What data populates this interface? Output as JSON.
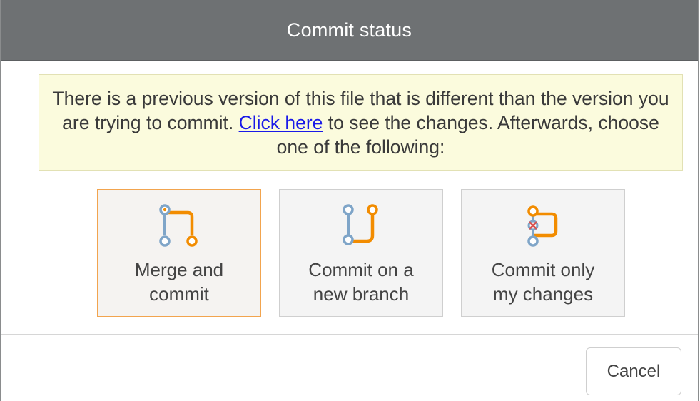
{
  "dialog": {
    "title": "Commit status"
  },
  "notice": {
    "text_before": "There is a previous version of this file that is different than the version you are trying to commit. ",
    "link_text": "Click here",
    "text_after": " to see the changes. Afterwards, choose one of the following:"
  },
  "options": [
    {
      "line1": "Merge and",
      "line2": "commit",
      "icon": "merge-icon",
      "selected": true
    },
    {
      "line1": "Commit on a",
      "line2": "new branch",
      "icon": "branch-icon",
      "selected": false
    },
    {
      "line1": "Commit only",
      "line2": "my changes",
      "icon": "commit-mine-icon",
      "selected": false
    }
  ],
  "footer": {
    "cancel_label": "Cancel"
  },
  "colors": {
    "titlebar": "#6e7173",
    "notice_bg": "#fbfbdd",
    "accent_orange": "#f28c00",
    "accent_blue": "#7fa5c8",
    "link": "#1a1ae8",
    "selected_border": "#f2a44e"
  }
}
